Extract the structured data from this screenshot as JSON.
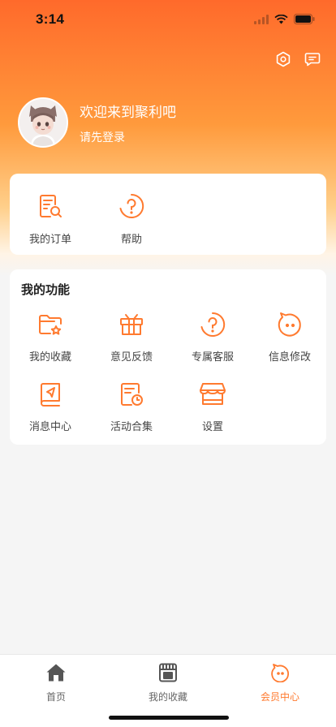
{
  "status_bar": {
    "time": "3:14"
  },
  "profile": {
    "welcome": "欢迎来到聚利吧",
    "login": "请先登录"
  },
  "quick": [
    {
      "label": "我的订单",
      "icon": "order-search-icon"
    },
    {
      "label": "帮助",
      "icon": "help-icon"
    }
  ],
  "functions": {
    "title": "我的功能",
    "items": [
      {
        "label": "我的收藏",
        "icon": "folder-star-icon"
      },
      {
        "label": "意见反馈",
        "icon": "gift-icon"
      },
      {
        "label": "专属客服",
        "icon": "help-circle-icon"
      },
      {
        "label": "信息修改",
        "icon": "face-icon"
      },
      {
        "label": "消息中心",
        "icon": "book-send-icon"
      },
      {
        "label": "活动合集",
        "icon": "calendar-clock-icon"
      },
      {
        "label": "设置",
        "icon": "store-icon"
      }
    ]
  },
  "tabs": [
    {
      "label": "首页",
      "icon": "home-icon",
      "active": false
    },
    {
      "label": "我的收藏",
      "icon": "shop-icon",
      "active": false
    },
    {
      "label": "会员中心",
      "icon": "face-icon",
      "active": true
    }
  ],
  "colors": {
    "accent": "#ff7a2f",
    "header_top": "#ff6a2b",
    "header_mid": "#ff9a3c"
  }
}
